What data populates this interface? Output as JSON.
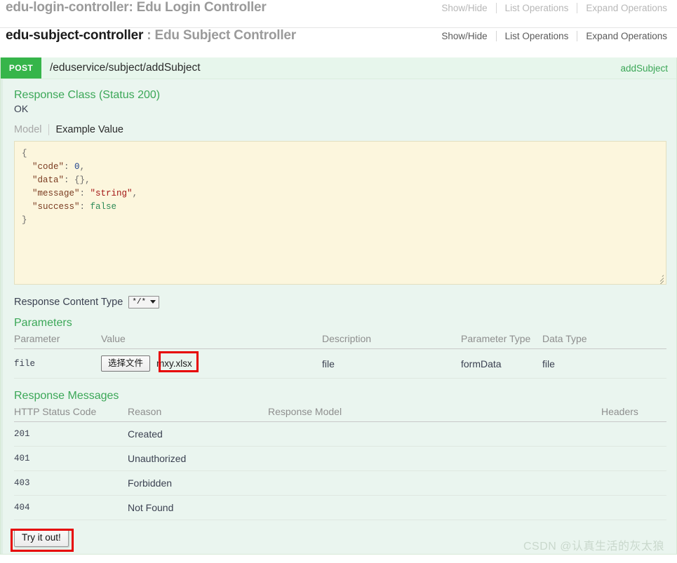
{
  "resources": [
    {
      "name": "edu-login-controller",
      "separator": ":",
      "description": "Edu Login Controller",
      "links": [
        "Show/Hide",
        "List Operations",
        "Expand Operations"
      ]
    },
    {
      "name": "edu-subject-controller",
      "separator": ":",
      "description": "Edu Subject Controller",
      "links": [
        "Show/Hide",
        "List Operations",
        "Expand Operations"
      ]
    }
  ],
  "operation": {
    "method": "POST",
    "path": "/eduservice/subject/addSubject",
    "nickname": "addSubject",
    "method_color": "#36b54a",
    "response_class_heading": "Response Class (Status 200)",
    "response_class_status": "OK",
    "tabs": {
      "model": "Model",
      "example": "Example Value"
    },
    "example_value": {
      "line1": "{",
      "code_key": "\"code\"",
      "code_val": "0",
      "data_key": "\"data\"",
      "data_val": "{}",
      "message_key": "\"message\"",
      "message_val": "\"string\"",
      "success_key": "\"success\"",
      "success_val": "false",
      "line_last": "}"
    },
    "response_content_type": {
      "label": "Response Content Type",
      "selected": "*/*"
    },
    "parameters": {
      "heading": "Parameters",
      "columns": [
        "Parameter",
        "Value",
        "Description",
        "Parameter Type",
        "Data Type"
      ],
      "rows": [
        {
          "parameter": "file",
          "value_button": "选择文件",
          "value_filename": "mxy.xlsx",
          "description": "file",
          "parameter_type": "formData",
          "data_type": "file"
        }
      ]
    },
    "response_messages": {
      "heading": "Response Messages",
      "columns": [
        "HTTP Status Code",
        "Reason",
        "Response Model",
        "Headers"
      ],
      "rows": [
        {
          "code": "201",
          "reason": "Created",
          "model": "",
          "headers": ""
        },
        {
          "code": "401",
          "reason": "Unauthorized",
          "model": "",
          "headers": ""
        },
        {
          "code": "403",
          "reason": "Forbidden",
          "model": "",
          "headers": ""
        },
        {
          "code": "404",
          "reason": "Not Found",
          "model": "",
          "headers": ""
        }
      ]
    },
    "try_it_out": "Try it out!"
  },
  "annotations": {
    "highlight_color": "#e60000"
  },
  "watermark": "CSDN @认真生活的灰太狼"
}
